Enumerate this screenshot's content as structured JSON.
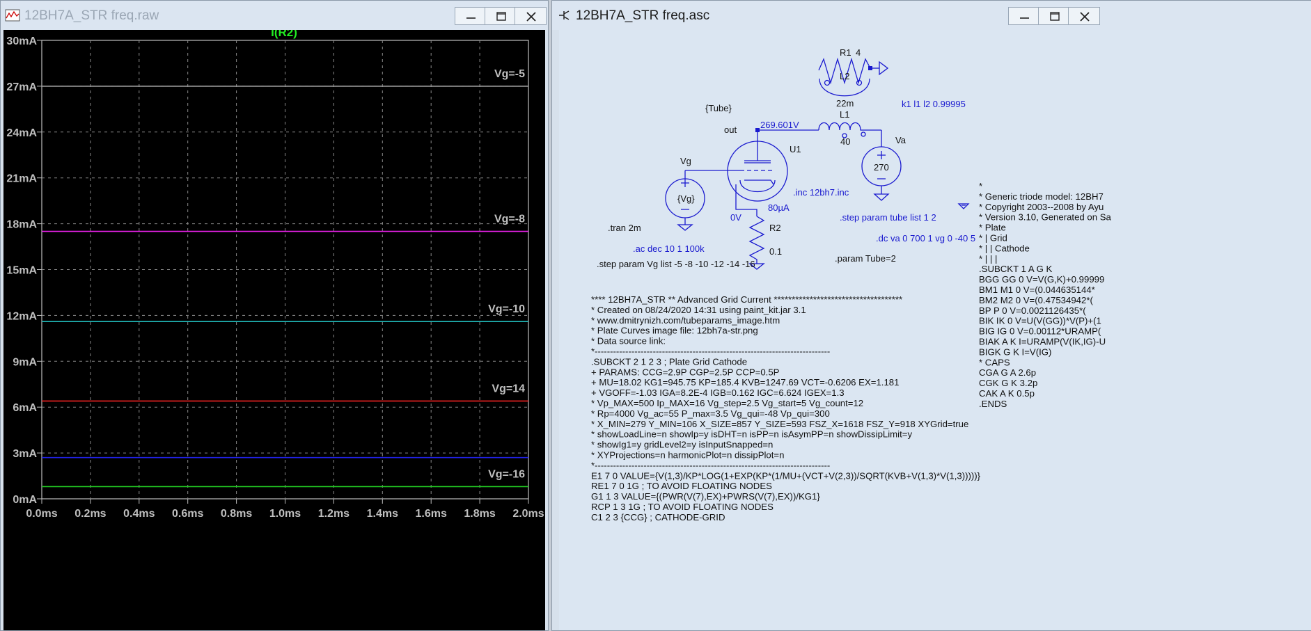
{
  "left_window": {
    "title": "12BH7A_STR freq.raw",
    "trace_label": "I(R2)",
    "colors": {
      "trace_label": "#22ee22",
      "plot_bg": "#000000",
      "axis": "#bfbfbf"
    }
  },
  "right_window": {
    "title": "12BH7A_STR freq.asc"
  },
  "chart_data": {
    "type": "line",
    "title": "I(R2)",
    "x": [
      0.0,
      2.0
    ],
    "xlim": [
      0.0,
      2.0
    ],
    "ylim": [
      0,
      30
    ],
    "x_unit": "ms",
    "y_unit": "mA",
    "x_ticks": [
      "0.0ms",
      "0.2ms",
      "0.4ms",
      "0.6ms",
      "0.8ms",
      "1.0ms",
      "1.2ms",
      "1.4ms",
      "1.6ms",
      "1.8ms",
      "2.0ms"
    ],
    "y_ticks": [
      "0mA",
      "3mA",
      "6mA",
      "9mA",
      "12mA",
      "15mA",
      "18mA",
      "21mA",
      "24mA",
      "27mA",
      "30mA"
    ],
    "grid": true,
    "series": [
      {
        "name": "Vg=-5",
        "values": [
          27.0,
          27.0
        ],
        "color": "#9c9c9c"
      },
      {
        "name": "Vg=-8",
        "values": [
          17.5,
          17.5
        ],
        "color": "#ee22ee"
      },
      {
        "name": "Vg=-10",
        "values": [
          11.6,
          11.6
        ],
        "color": "#22bbbb"
      },
      {
        "name": "Vg=14",
        "values": [
          6.4,
          6.4
        ],
        "color": "#ee2222"
      },
      {
        "name": "Vg=-16",
        "values": [
          0.8,
          0.8
        ],
        "color": "#22cc22"
      }
    ],
    "extra_series": [
      {
        "values": [
          2.7,
          2.7
        ],
        "color": "#2222ee"
      }
    ]
  },
  "schematic": {
    "labels": {
      "r1": "R1",
      "r1_val": "4",
      "l2": "L2",
      "l2_val": "22m",
      "tube": "{Tube}",
      "k1": "k1 l1 l2 0.99995",
      "l1": "L1",
      "l1_val": "40",
      "out": "out",
      "voltage": "269.601V",
      "u1": "U1",
      "va": "Va",
      "va_val": "270",
      "vg": "Vg",
      "vg_val": "{Vg}",
      "inc": ".inc  12bh7.inc",
      "zero_v": "0V",
      "current": "80µA",
      "r2": "R2",
      "r2_val": "0.1",
      "step_tube": ".step param tube list 1 2",
      "tran": ".tran 2m",
      "ac": ".ac dec 10 1 100k",
      "dc": ".dc va 0 700 1 vg 0 -40 5",
      "step_vg": ".step param Vg list -5 -8 -10 -12 -14 -16",
      "param_tube": ".param Tube=2"
    },
    "netlist_main": [
      "**** 12BH7A_STR ** Advanced Grid Current ************************************",
      "* Created on 08/24/2020 14:31 using paint_kit.jar 3.1",
      "* www.dmitrynizh.com/tubeparams_image.htm",
      "* Plate Curves image file: 12bh7a-str.png",
      "* Data source link:",
      "*-----------------------------------------------------------------------------",
      ".SUBCKT  2 1 2 3 ; Plate Grid Cathode",
      "+ PARAMS: CCG=2.9P  CGP=2.5P CCP=0.5P",
      "+ MU=18.02 KG1=945.75 KP=185.4 KVB=1247.69 VCT=-0.6206 EX=1.181",
      "+ VGOFF=-1.03 IGA=8.2E-4 IGB=0.162 IGC=6.624 IGEX=1.3",
      "* Vp_MAX=500 Ip_MAX=16 Vg_step=2.5 Vg_start=5 Vg_count=12",
      "* Rp=4000 Vg_ac=55 P_max=3.5 Vg_qui=-48 Vp_qui=300",
      "* X_MIN=279 Y_MIN=106 X_SIZE=857 Y_SIZE=593 FSZ_X=1618 FSZ_Y=918 XYGrid=true",
      "* showLoadLine=n showIp=y isDHT=n isPP=n isAsymPP=n showDissipLimit=y",
      "* showIg1=y gridLevel2=y isInputSnapped=n",
      "* XYProjections=n harmonicPlot=n dissipPlot=n",
      "*-----------------------------------------------------------------------------",
      "E1 7 0 VALUE={V(1,3)/KP*LOG(1+EXP(KP*(1/MU+(VCT+V(2,3))/SQRT(KVB+V(1,3)*V(1,3)))))}",
      "RE1 7 0 1G  ; TO AVOID FLOATING NODES",
      "G1 1 3 VALUE={(PWR(V(7),EX)+PWRS(V(7),EX))/KG1}",
      "RCP 1 3 1G   ; TO AVOID FLOATING NODES",
      "C1 2 3 {CCG} ; CATHODE-GRID"
    ],
    "netlist_side": [
      "*",
      "* Generic triode model: 12BH7",
      "* Copyright 2003--2008 by Ayu",
      "* Version 3.10, Generated on Sa",
      "*              Plate",
      "*              | Grid",
      "*              | | Cathode",
      "*              | | |",
      ".SUBCKT 1 A G K",
      "BGG   GG   0 V=V(G,K)+0.99999",
      "BM1   M1   0 V=(0.044635144*",
      "BM2   M2   0 V=(0.47534942*(",
      "BP    P    0 V=0.0021126435*(",
      "BIK   IK   0 V=U(V(GG))*V(P)+(1",
      "BIG   IG   0 V=0.00112*URAMP(",
      "BIAK  A    K I=URAMP(V(IK,IG)-U",
      "BIGK  G    K I=V(IG)",
      "* CAPS",
      "CGA   G    A 2.6p",
      "CGK   G    K 3.2p",
      "CAK   A    K 0.5p",
      ".ENDS"
    ]
  }
}
